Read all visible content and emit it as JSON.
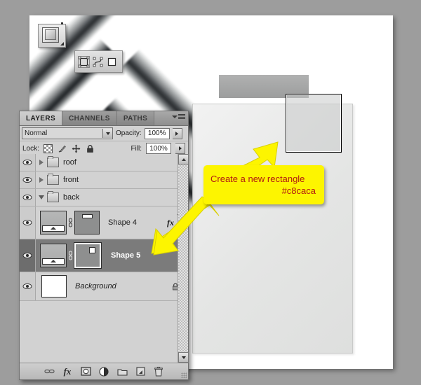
{
  "app": {
    "background_color": "#9d9d9d",
    "canvas_color": "#ffffff"
  },
  "tools": {
    "style_swatch": {
      "name": "layer-style-swatch"
    },
    "shape_mode_bar": {
      "buttons": [
        {
          "name": "shape-layers-icon",
          "selected": true
        },
        {
          "name": "paths-icon",
          "selected": false
        },
        {
          "name": "fill-pixels-icon",
          "selected": false
        }
      ]
    }
  },
  "panel": {
    "tabs": [
      {
        "label": "LAYERS",
        "active": true
      },
      {
        "label": "CHANNELS",
        "active": false
      },
      {
        "label": "PATHS",
        "active": false
      }
    ],
    "menu_icon": "panel-menu-icon",
    "blend_mode": "Normal",
    "opacity_label": "Opacity:",
    "opacity_value": "100%",
    "lock_label": "Lock:",
    "lock_icons": [
      "lock-transparency-icon",
      "lock-image-icon",
      "lock-position-icon",
      "lock-all-icon"
    ],
    "fill_label": "Fill:",
    "fill_value": "100%",
    "layers": [
      {
        "name": "roof",
        "type": "group",
        "expanded": false,
        "visible": true,
        "selected": false
      },
      {
        "name": "front",
        "type": "group",
        "expanded": false,
        "visible": true,
        "selected": false
      },
      {
        "name": "back",
        "type": "group",
        "expanded": true,
        "visible": true,
        "selected": false
      },
      {
        "name": "Shape 4",
        "type": "shape",
        "visible": true,
        "selected": false,
        "fx": "fx",
        "mask": "slot"
      },
      {
        "name": "Shape 5",
        "type": "shape",
        "visible": true,
        "selected": true,
        "mask": "square"
      },
      {
        "name": "Background",
        "type": "background",
        "visible": true,
        "selected": false,
        "locked": true
      }
    ],
    "bottom_buttons": [
      "link-layers-icon",
      "add-layer-style-icon",
      "add-layer-mask-icon",
      "new-adjustment-layer-icon",
      "new-group-icon",
      "new-layer-icon",
      "delete-layer-icon"
    ]
  },
  "callout": {
    "line1": "Create a new rectangle",
    "line2": "#c8caca",
    "fill_color": "#fdf500",
    "text_color": "#b11a12"
  },
  "artwork": {
    "selection_rect_color": "#c8caca",
    "notes": "house chevron roof with metallic gradient, rear bar and front face"
  }
}
